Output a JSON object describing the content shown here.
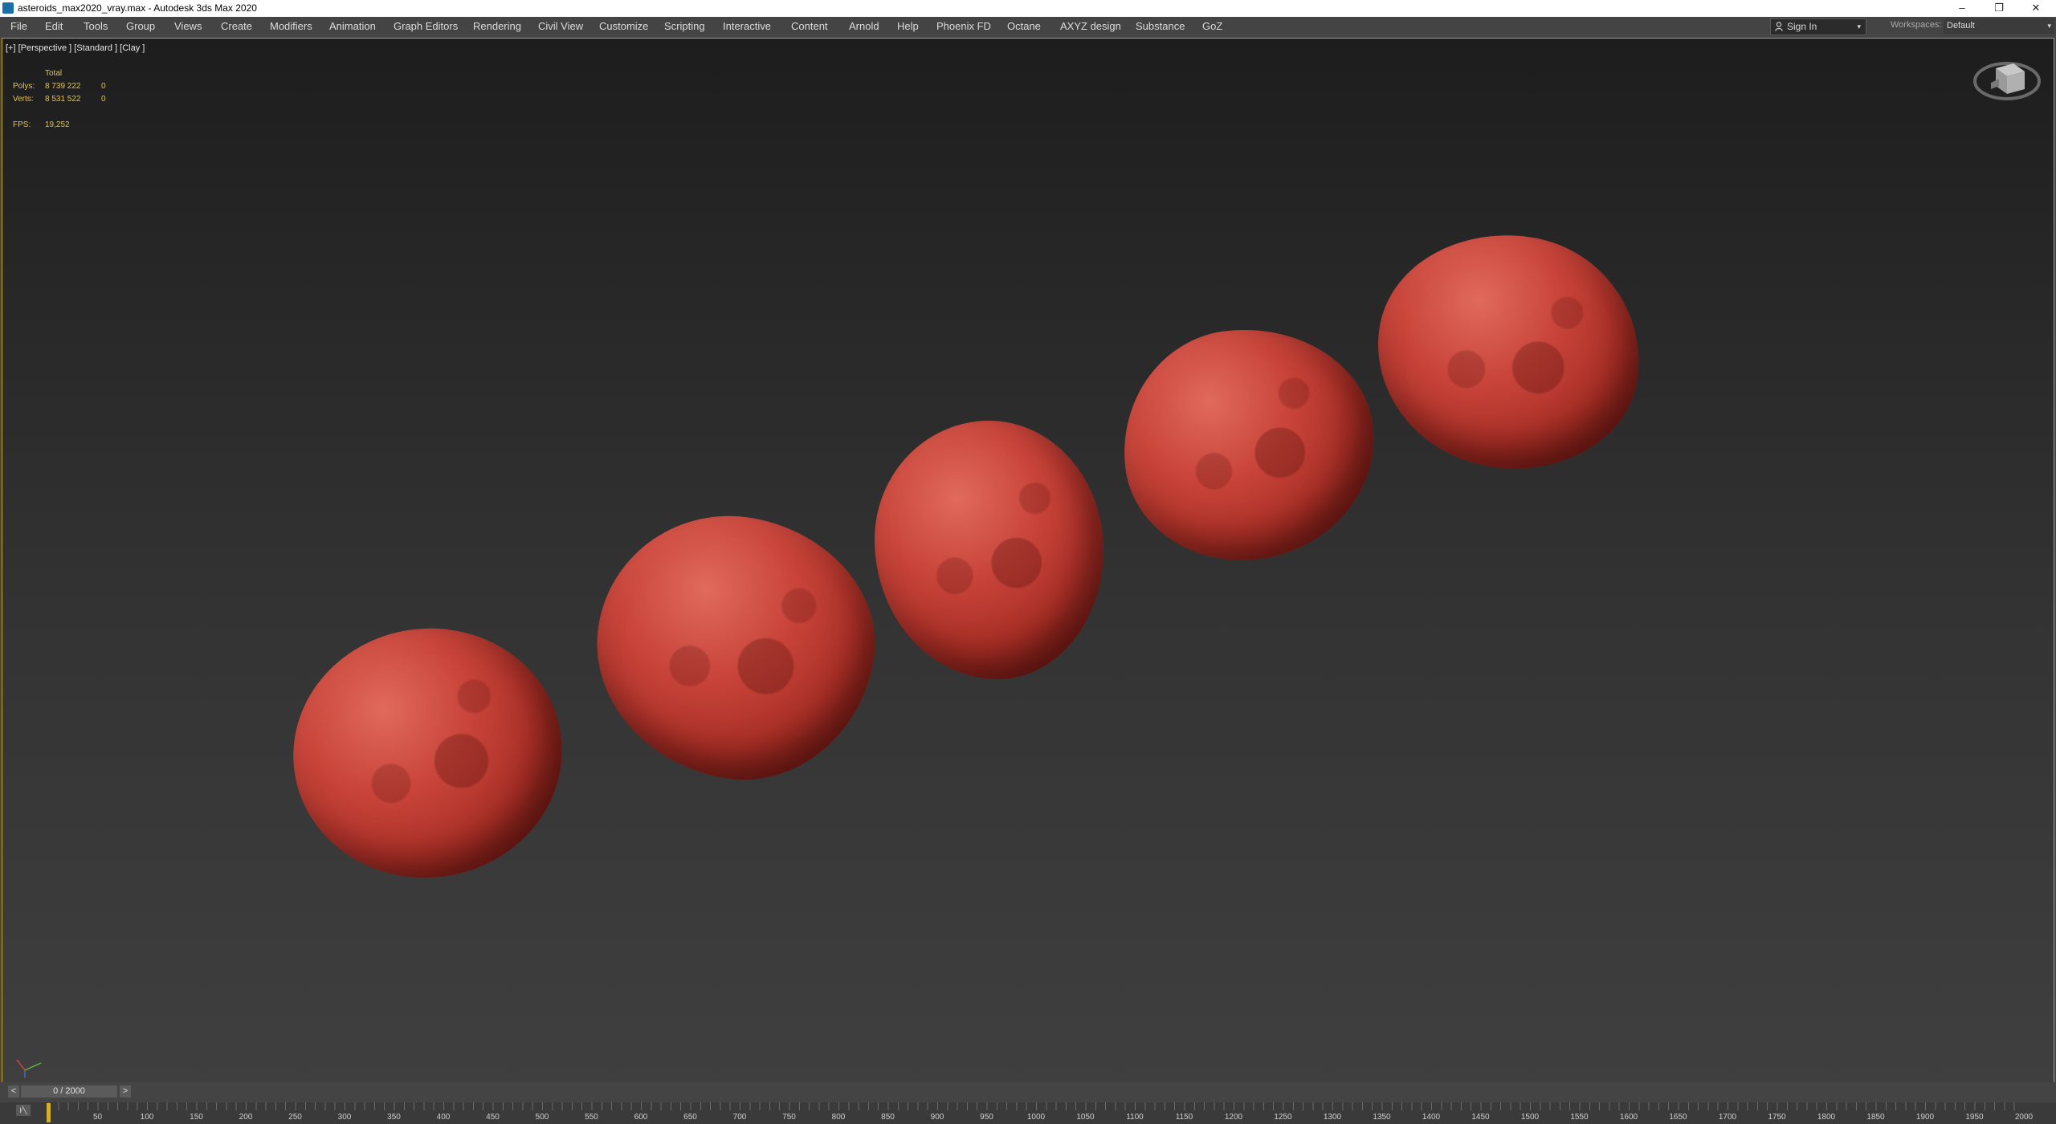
{
  "window": {
    "title": "asteroids_max2020_vray.max - Autodesk 3ds Max 2020",
    "minimize_glyph": "–",
    "restore_glyph": "❐",
    "close_glyph": "✕"
  },
  "menu": {
    "items": [
      "File",
      "Edit",
      "Tools",
      "Group",
      "Views",
      "Create",
      "Modifiers",
      "Animation",
      "Graph Editors",
      "Rendering",
      "Civil View",
      "Customize",
      "Scripting",
      "Interactive",
      "Content",
      "Arnold",
      "Help",
      "Phoenix FD",
      "Octane",
      "AXYZ design",
      "Substance",
      "GoZ"
    ]
  },
  "account": {
    "signin_label": "Sign In",
    "workspaces_label": "Workspaces:",
    "workspace_value": "Default",
    "caret": "▾"
  },
  "viewport": {
    "label": "[+] [Perspective ] [Standard ] [Clay ]",
    "stats": {
      "header": "Total",
      "polys_label": "Polys:",
      "polys_total": "8 739 222",
      "polys_selected": "0",
      "verts_label": "Verts:",
      "verts_total": "8 531 522",
      "verts_selected": "0",
      "fps_label": "FPS:",
      "fps_value": "19,252"
    },
    "object_color": "#c9443a",
    "selection_border_color": "#c9a400"
  },
  "timeline": {
    "frame_counter": "0 / 2000",
    "prev_glyph": "<",
    "next_glyph": ">",
    "mini_curve_label": "l∕╲",
    "tick_labels": [
      "50",
      "100",
      "150",
      "200",
      "250",
      "300",
      "350",
      "400",
      "450",
      "500",
      "550",
      "600",
      "650",
      "700",
      "750",
      "800",
      "850",
      "900",
      "950",
      "1000",
      "1050",
      "1100",
      "1150",
      "1200",
      "1250",
      "1300",
      "1350",
      "1400",
      "1450",
      "1500",
      "1550",
      "1600",
      "1650",
      "1700",
      "1750",
      "1800",
      "1850",
      "1900",
      "1950",
      "2000"
    ],
    "current_frame": 0,
    "total_frames": 2000
  }
}
